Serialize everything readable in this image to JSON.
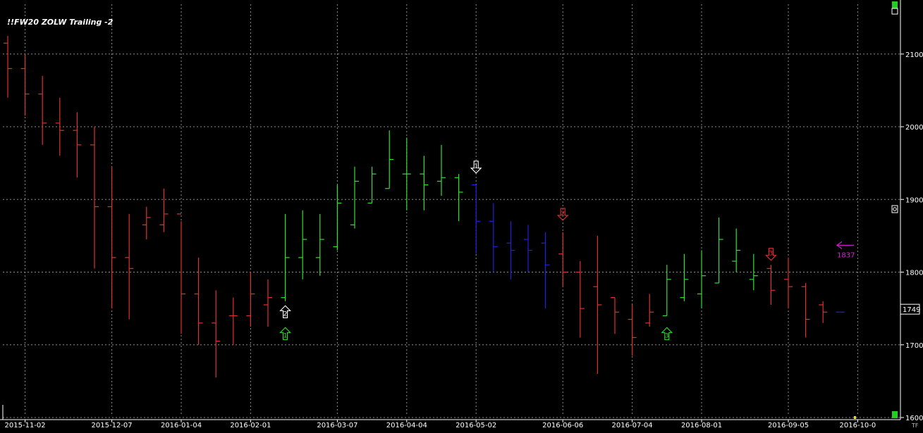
{
  "chart_data": {
    "type": "bar",
    "title": "!!FW20 ZOLW Trailing -2",
    "ylim": [
      1600,
      2140
    ],
    "yticks": [
      "1600",
      "1700",
      "1800",
      "1900",
      "2000",
      "2100"
    ],
    "xticks": [
      {
        "label": "2015-11-02",
        "i": 1
      },
      {
        "label": "2015-12-07",
        "i": 6
      },
      {
        "label": "2016-01-04",
        "i": 10
      },
      {
        "label": "2016-02-01",
        "i": 14
      },
      {
        "label": "2016-03-07",
        "i": 19
      },
      {
        "label": "2016-04-04",
        "i": 23
      },
      {
        "label": "2016-05-02",
        "i": 27
      },
      {
        "label": "2016-06-06",
        "i": 32
      },
      {
        "label": "2016-07-04",
        "i": 36
      },
      {
        "label": "2016-08-01",
        "i": 40
      },
      {
        "label": "2016-09-05",
        "i": 45
      },
      {
        "label": "2016-10-0",
        "i": 49
      }
    ],
    "grid": true,
    "colors": {
      "down": "#e03030",
      "up": "#30e030",
      "blue": "#2020e0",
      "signal_white": "#ffffff",
      "signal_green": "#30e030",
      "signal_red": "#e03030",
      "magenta": "#e020e0"
    },
    "bars": [
      {
        "h": 2125,
        "l": 2040,
        "o": 2115,
        "c": 2080,
        "col": "down"
      },
      {
        "h": 2100,
        "l": 2015,
        "o": 2080,
        "c": 2045,
        "col": "down"
      },
      {
        "h": 2070,
        "l": 1975,
        "o": 2045,
        "c": 2005,
        "col": "down"
      },
      {
        "h": 2040,
        "l": 1960,
        "o": 2005,
        "c": 1995,
        "col": "down"
      },
      {
        "h": 2020,
        "l": 1930,
        "o": 1995,
        "c": 1975,
        "col": "down"
      },
      {
        "h": 2000,
        "l": 1805,
        "o": 1975,
        "c": 1890,
        "col": "down"
      },
      {
        "h": 1945,
        "l": 1750,
        "o": 1890,
        "c": 1820,
        "col": "down"
      },
      {
        "h": 1880,
        "l": 1735,
        "o": 1820,
        "c": 1805,
        "col": "down"
      },
      {
        "h": 1890,
        "l": 1845,
        "o": 1865,
        "c": 1875,
        "col": "down"
      },
      {
        "h": 1915,
        "l": 1855,
        "o": 1865,
        "c": 1880,
        "col": "down"
      },
      {
        "h": 1870,
        "l": 1715,
        "o": 1880,
        "c": 1770,
        "col": "down"
      },
      {
        "h": 1820,
        "l": 1700,
        "o": 1770,
        "c": 1730,
        "col": "down"
      },
      {
        "h": 1775,
        "l": 1655,
        "o": 1730,
        "c": 1705,
        "col": "down"
      },
      {
        "h": 1765,
        "l": 1700,
        "o": 1740,
        "c": 1740,
        "col": "down"
      },
      {
        "h": 1800,
        "l": 1725,
        "o": 1740,
        "c": 1770,
        "col": "down"
      },
      {
        "h": 1790,
        "l": 1725,
        "o": 1755,
        "c": 1765,
        "col": "down"
      },
      {
        "h": 1880,
        "l": 1760,
        "o": 1765,
        "c": 1820,
        "col": "up"
      },
      {
        "h": 1885,
        "l": 1790,
        "o": 1820,
        "c": 1845,
        "col": "up"
      },
      {
        "h": 1880,
        "l": 1795,
        "o": 1820,
        "c": 1845,
        "col": "up"
      },
      {
        "h": 1920,
        "l": 1830,
        "o": 1835,
        "c": 1895,
        "col": "up"
      },
      {
        "h": 1945,
        "l": 1860,
        "o": 1865,
        "c": 1925,
        "col": "up"
      },
      {
        "h": 1945,
        "l": 1895,
        "o": 1895,
        "c": 1935,
        "col": "up"
      },
      {
        "h": 1995,
        "l": 1915,
        "o": 1915,
        "c": 1955,
        "col": "up"
      },
      {
        "h": 1985,
        "l": 1885,
        "o": 1935,
        "c": 1935,
        "col": "up"
      },
      {
        "h": 1960,
        "l": 1885,
        "o": 1935,
        "c": 1920,
        "col": "up"
      },
      {
        "h": 1975,
        "l": 1905,
        "o": 1925,
        "c": 1930,
        "col": "up"
      },
      {
        "h": 1935,
        "l": 1870,
        "o": 1930,
        "c": 1910,
        "col": "up"
      },
      {
        "h": 1920,
        "l": 1825,
        "o": 1920,
        "c": 1870,
        "col": "blue"
      },
      {
        "h": 1895,
        "l": 1800,
        "o": 1870,
        "c": 1835,
        "col": "blue"
      },
      {
        "h": 1870,
        "l": 1790,
        "o": 1840,
        "c": 1830,
        "col": "blue"
      },
      {
        "h": 1865,
        "l": 1800,
        "o": 1845,
        "c": 1830,
        "col": "blue"
      },
      {
        "h": 1855,
        "l": 1750,
        "o": 1840,
        "c": 1810,
        "col": "blue"
      },
      {
        "h": 1855,
        "l": 1780,
        "o": 1825,
        "c": 1800,
        "col": "down"
      },
      {
        "h": 1815,
        "l": 1710,
        "o": 1800,
        "c": 1750,
        "col": "down"
      },
      {
        "h": 1850,
        "l": 1660,
        "o": 1780,
        "c": 1755,
        "col": "down"
      },
      {
        "h": 1765,
        "l": 1715,
        "o": 1765,
        "c": 1745,
        "col": "down"
      },
      {
        "h": 1755,
        "l": 1685,
        "o": 1735,
        "c": 1710,
        "col": "down"
      },
      {
        "h": 1770,
        "l": 1725,
        "o": 1730,
        "c": 1745,
        "col": "down"
      },
      {
        "h": 1810,
        "l": 1740,
        "o": 1740,
        "c": 1790,
        "col": "up"
      },
      {
        "h": 1825,
        "l": 1760,
        "o": 1765,
        "c": 1790,
        "col": "up"
      },
      {
        "h": 1830,
        "l": 1750,
        "o": 1770,
        "c": 1795,
        "col": "up"
      },
      {
        "h": 1875,
        "l": 1785,
        "o": 1785,
        "c": 1845,
        "col": "up"
      },
      {
        "h": 1860,
        "l": 1800,
        "o": 1815,
        "c": 1830,
        "col": "up"
      },
      {
        "h": 1825,
        "l": 1775,
        "o": 1790,
        "c": 1795,
        "col": "up"
      },
      {
        "h": 1810,
        "l": 1755,
        "o": 1805,
        "c": 1775,
        "col": "down"
      },
      {
        "h": 1820,
        "l": 1750,
        "o": 1790,
        "c": 1780,
        "col": "down"
      },
      {
        "h": 1785,
        "l": 1710,
        "o": 1780,
        "c": 1735,
        "col": "down"
      },
      {
        "h": 1760,
        "l": 1730,
        "o": 1755,
        "c": 1745,
        "col": "down"
      },
      {
        "h": 1745,
        "l": 1745,
        "o": 1745,
        "c": 1745,
        "col": "blue"
      }
    ],
    "signals": [
      {
        "i": 16,
        "v": 1745,
        "dir": "up",
        "col": "signal_white",
        "label": "2"
      },
      {
        "i": 16,
        "v": 1715,
        "dir": "up",
        "col": "signal_green",
        "label": "1"
      },
      {
        "i": 27,
        "v": 1945,
        "dir": "down",
        "col": "signal_white",
        "label": "1"
      },
      {
        "i": 32,
        "v": 1880,
        "dir": "down",
        "col": "signal_red",
        "label": "2"
      },
      {
        "i": 38,
        "v": 1715,
        "dir": "up",
        "col": "signal_green",
        "label": "3"
      },
      {
        "i": 44,
        "v": 1825,
        "dir": "down",
        "col": "signal_red",
        "label": "3"
      }
    ],
    "annotation": {
      "text": "1837",
      "v": 1837,
      "col": "magenta"
    },
    "last_price": "1749",
    "corner_label": "TF"
  }
}
